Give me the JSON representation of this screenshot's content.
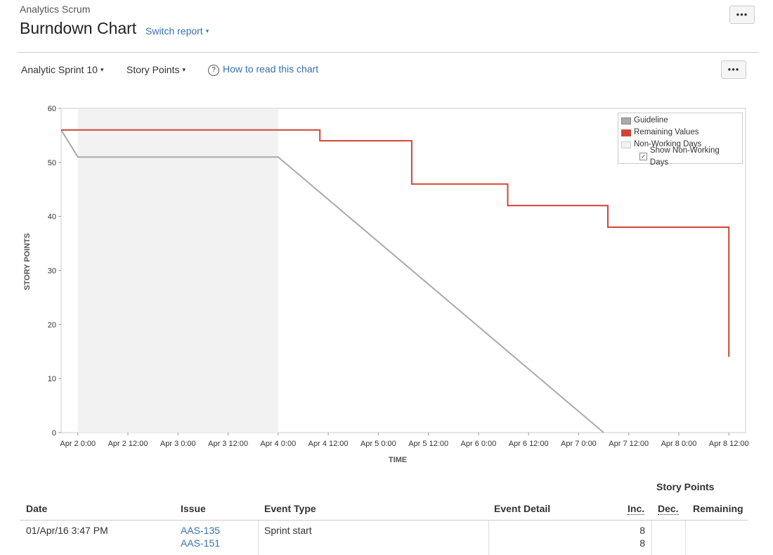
{
  "header": {
    "project": "Analytics Scrum",
    "title": "Burndown Chart",
    "switch_report": "Switch report",
    "more_label": "•••"
  },
  "toolbar": {
    "sprint": "Analytic Sprint 10",
    "estimate": "Story Points",
    "help": "How to read this chart",
    "more_label": "•••"
  },
  "colors": {
    "guideline": "#aaaaaa",
    "remaining": "#d04437",
    "non_working": "#f2f2f2",
    "link": "#3572b0"
  },
  "legend": {
    "guideline": "Guideline",
    "remaining": "Remaining Values",
    "non_working": "Non-Working Days",
    "show_non_working": "Show Non-Working Days",
    "show_non_working_checked": true
  },
  "chart_data": {
    "type": "line",
    "ylabel": "STORY POINTS",
    "xlabel": "TIME",
    "ylim": [
      0,
      60
    ],
    "y_ticks": [
      "0",
      "10",
      "20",
      "30",
      "40",
      "50",
      "60"
    ],
    "x_ticks": [
      "Apr 2 0:00",
      "Apr 2 12:00",
      "Apr 3 0:00",
      "Apr 3 12:00",
      "Apr 4 0:00",
      "Apr 4 12:00",
      "Apr 5 0:00",
      "Apr 5 12:00",
      "Apr 6 0:00",
      "Apr 6 12:00",
      "Apr 7 0:00",
      "Apr 7 12:00",
      "Apr 8 0:00",
      "Apr 8 12:00"
    ],
    "x_range_hours": [
      -4,
      12
    ],
    "non_working_range_hours": [
      0,
      48
    ],
    "series": [
      {
        "name": "Guideline",
        "points": [
          [
            -4,
            56
          ],
          [
            0,
            51
          ],
          [
            48,
            51
          ],
          [
            126,
            0
          ]
        ]
      },
      {
        "name": "Remaining Values",
        "points": [
          [
            -4,
            56
          ],
          [
            58,
            56
          ],
          [
            58,
            54
          ],
          [
            80,
            54
          ],
          [
            80,
            46
          ],
          [
            103,
            46
          ],
          [
            103,
            42
          ],
          [
            127,
            42
          ],
          [
            127,
            38
          ],
          [
            156,
            38
          ],
          [
            156,
            14
          ]
        ]
      }
    ]
  },
  "table": {
    "group_header": "Story Points",
    "columns": [
      "Date",
      "Issue",
      "Event Type",
      "Event Detail",
      "Inc.",
      "Dec.",
      "Remaining"
    ],
    "rows": [
      {
        "date": "01/Apr/16 3:47 PM",
        "issues": [
          "AAS-135",
          "AAS-151"
        ],
        "event_type": "Sprint start",
        "event_detail": "",
        "inc": [
          "8",
          "8"
        ],
        "dec": "",
        "remaining": ""
      }
    ]
  }
}
